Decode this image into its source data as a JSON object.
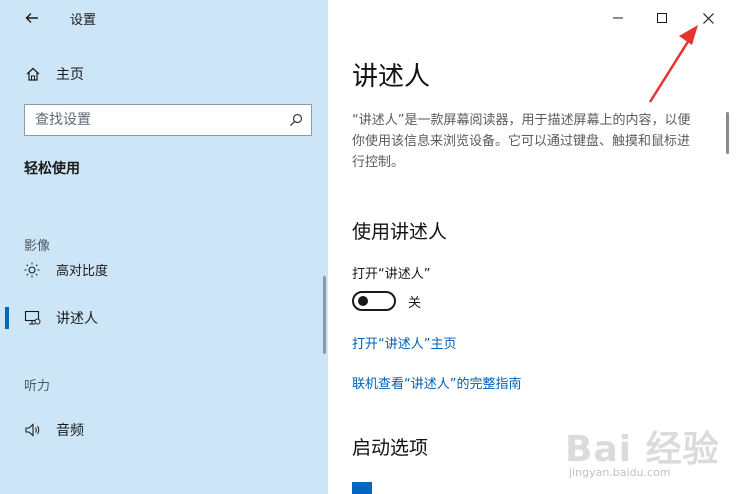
{
  "window": {
    "title": "设置"
  },
  "sidebar": {
    "home_label": "主页",
    "search_placeholder": "查找设置",
    "section_title": "轻松使用",
    "groups": [
      {
        "label": "影像",
        "items": [
          {
            "label": "高对比度",
            "icon": "high-contrast-icon"
          }
        ]
      },
      {
        "label": "",
        "items": [
          {
            "label": "讲述人",
            "icon": "narrator-icon",
            "selected": true
          }
        ]
      },
      {
        "label": "听力",
        "items": [
          {
            "label": "音频",
            "icon": "speaker-icon"
          }
        ]
      }
    ]
  },
  "main": {
    "title": "讲述人",
    "description": "“讲述人”是一款屏幕阅读器，用于描述屏幕上的内容，以便你使用该信息来浏览设备。它可以通过键盘、触摸和鼠标进行控制。",
    "use_heading": "使用讲述人",
    "toggle": {
      "label": "打开“讲述人”",
      "state_label": "关",
      "on": false
    },
    "links": [
      "打开“讲述人”主页",
      "联机查看“讲述人”的完整指南"
    ],
    "startup_heading": "启动选项"
  },
  "watermark": {
    "logo": "Bai 经验",
    "url": "jingyan.baidu.com"
  },
  "colors": {
    "sidebar_bg": "#cde6f7",
    "accent": "#0067c0",
    "link": "#0060b5",
    "annotation": "#e8322f"
  }
}
